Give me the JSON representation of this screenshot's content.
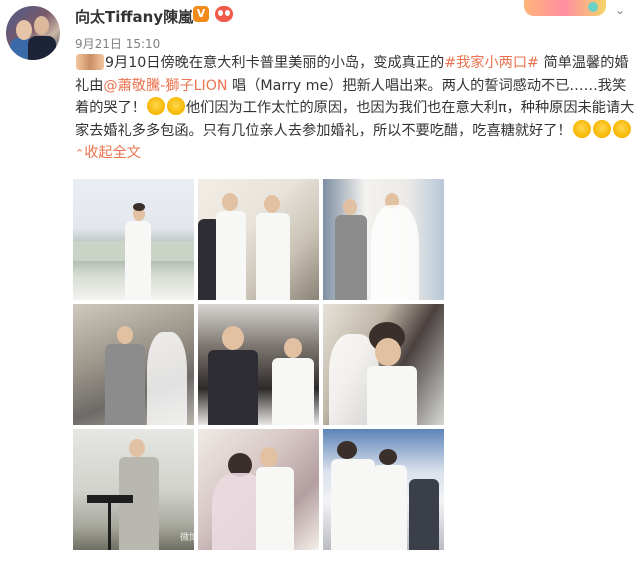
{
  "post": {
    "username": "向太Tiffany陳嵐",
    "vip_badge": "V",
    "timestamp": "9月21日 15:10",
    "text": {
      "seg1": "9月10日傍晚在意大利卡普里美丽的小岛，变成真正的",
      "hashtag": "#我家小两口#",
      "seg2": " 简单温馨的婚礼由",
      "mention": "@蕭敬騰-獅子LION",
      "seg3": " 唱（Marry me）把新人唱出来。两人的誓词感动不已……我笑着的哭了！",
      "seg4": "他们因为工作太忙的原因，也因为我们也在意大利π，种种原因未能请大家去婚礼多多包函。只有几位亲人去参加婚礼，所以不要吃醋，吃喜糖就好了！",
      "collapse": "收起全文"
    },
    "photos": [
      "singer-on-cliff-photo",
      "groomsmen-photo",
      "bride-walk-photo",
      "vows-photo",
      "guests-photo",
      "couple-closeup-photo",
      "singer-at-stand-photo",
      "couple-embrace-photo",
      "singer-with-couple-photo"
    ],
    "watermark": "微博"
  },
  "colors": {
    "link": "#eb7350",
    "text": "#333333",
    "meta": "#808080"
  }
}
